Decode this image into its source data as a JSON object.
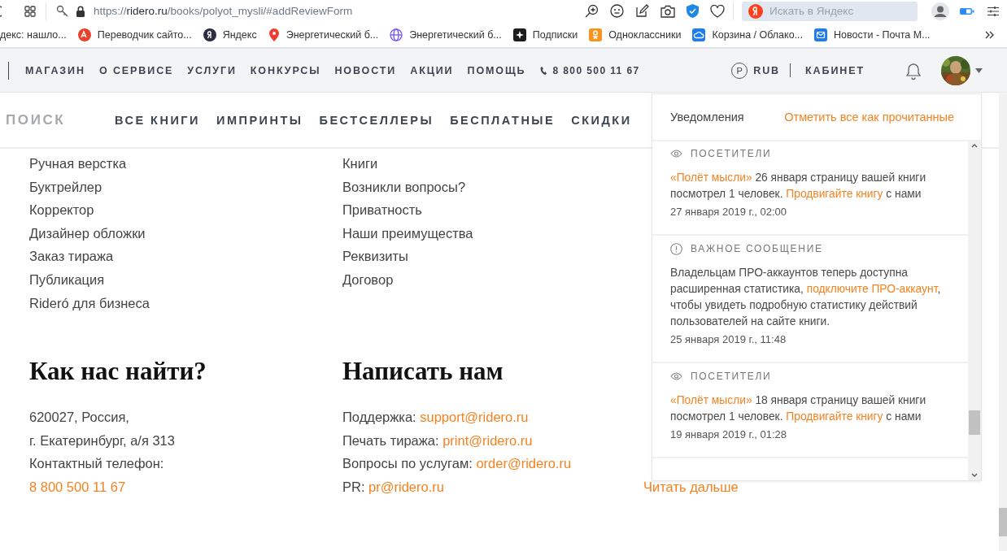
{
  "browser": {
    "url": {
      "scheme": "https://",
      "host": "ridero.ru",
      "path": "/books/polyot_mysli/#addReviewForm"
    },
    "search": {
      "placeholder": "Искать в Яндекс"
    }
  },
  "bookmarks": [
    {
      "kind": "none",
      "label": "декс: нашло..."
    },
    {
      "kind": "translate",
      "label": "Переводчик сайто..."
    },
    {
      "kind": "yandex",
      "label": "Яндекс"
    },
    {
      "kind": "pin",
      "label": "Энергетический б..."
    },
    {
      "kind": "globe",
      "label": "Энергетический б..."
    },
    {
      "kind": "star",
      "label": "Подписки"
    },
    {
      "kind": "ok",
      "label": "Одноклассники"
    },
    {
      "kind": "cloud",
      "label": "Корзина / Облако..."
    },
    {
      "kind": "mail",
      "label": "Новости - Почта М..."
    }
  ],
  "site_nav": {
    "items": [
      "МАГАЗИН",
      "О СЕРВИСЕ",
      "УСЛУГИ",
      "КОНКУРСЫ",
      "НОВОСТИ",
      "АКЦИИ",
      "ПОМОЩЬ"
    ],
    "phone": "8 800 500 11 67",
    "currency_symbol": "P",
    "currency": "RUB",
    "cabinet": "КАБИНЕТ"
  },
  "catalog_nav": {
    "search": {
      "placeholder": "ПОИСК"
    },
    "items": [
      "ВСЕ КНИГИ",
      "ИМПРИНТЫ",
      "БЕСТСЕЛЛЕРЫ",
      "БЕСПЛАТНЫЕ",
      "СКИДКИ"
    ]
  },
  "footer": {
    "links_col1": [
      "Ручная верстка",
      "Буктрейлер",
      "Корректор",
      "Дизайнер обложки",
      "Заказ тиража",
      "Публикация",
      "Rideró для бизнеса"
    ],
    "links_col2": [
      "Книги",
      "Возникли вопросы?",
      "Приватность",
      "Наши преимущества",
      "Реквизиты",
      "Договор"
    ],
    "find_us": {
      "title": "Как нас найти?",
      "lines": [
        "620027, Россия,",
        "г. Екатеринбург, а/я 313",
        "Контактный телефон:"
      ],
      "phone": "8 800 500 11 67"
    },
    "write_us": {
      "title": "Написать нам",
      "contacts": [
        {
          "label": "Поддержка:",
          "link": "support@ridero.ru"
        },
        {
          "label": "Печать тиража:",
          "link": "print@ridero.ru"
        },
        {
          "label": "Вопросы по услугам:",
          "link": "order@ridero.ru"
        },
        {
          "label": "PR:",
          "link": "pr@ridero.ru"
        }
      ]
    },
    "read_more": "Читать дальше"
  },
  "notifications": {
    "title": "Уведомления",
    "mark_all": "Отметить все как прочитанные",
    "items": [
      {
        "kind": "visitors",
        "category": "ПОСЕТИТЕЛИ",
        "parts": [
          {
            "text": "«Полёт мысли»",
            "link": true
          },
          {
            "text": " 26 января страницу вашей книги посмотрел 1 человек. ",
            "link": false
          },
          {
            "text": "Продвигайте книгу",
            "link": true
          },
          {
            "text": " с нами",
            "link": false
          }
        ],
        "time": "27 января 2019 г., 02:00"
      },
      {
        "kind": "important",
        "category": "ВАЖНОЕ СООБЩЕНИЕ",
        "parts": [
          {
            "text": "Владельцам ПРО-аккаунтов теперь доступна расширенная статистика, ",
            "link": false
          },
          {
            "text": "подключите ПРО-аккаунт",
            "link": true
          },
          {
            "text": ", чтобы увидеть подробную статистику действий пользователей на сайте книги.",
            "link": false
          }
        ],
        "time": "25 января 2019 г., 11:48"
      },
      {
        "kind": "visitors",
        "category": "ПОСЕТИТЕЛИ",
        "parts": [
          {
            "text": "«Полёт мысли»",
            "link": true
          },
          {
            "text": " 18 января страницу вашей книги посмотрел 1 человек. ",
            "link": false
          },
          {
            "text": "Продвигайте книгу",
            "link": true
          },
          {
            "text": " с нами",
            "link": false
          }
        ],
        "time": "19 января 2019 г., 01:28"
      }
    ]
  }
}
